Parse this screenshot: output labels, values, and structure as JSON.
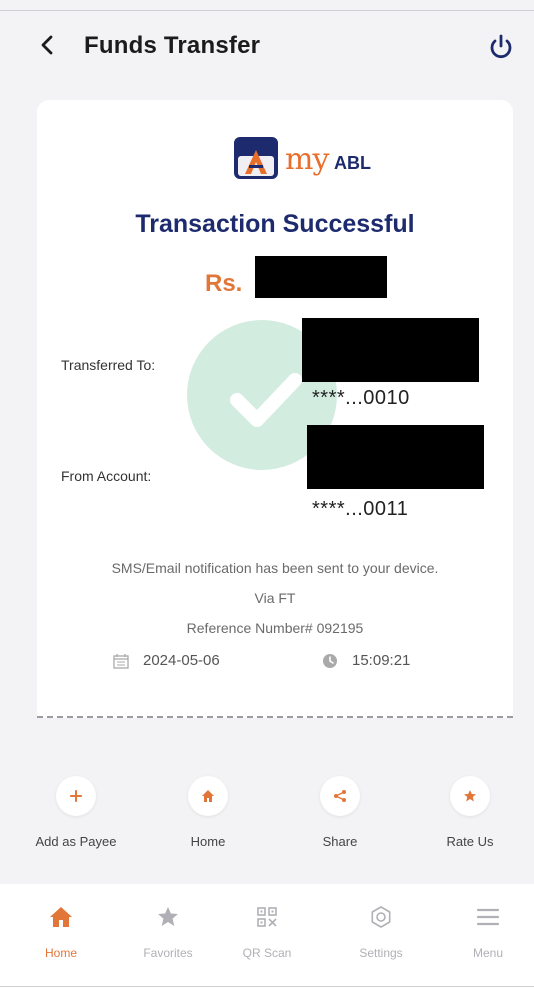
{
  "header": {
    "title": "Funds Transfer",
    "back_icon": "chevron-left-icon",
    "power_icon": "power-icon"
  },
  "receipt": {
    "logo_icon": "myabl-logo",
    "logo_word": "my",
    "logo_abl": "ABL",
    "status": "Transaction Successful",
    "currency": "Rs.",
    "transferred_to_label": "Transferred To:",
    "transferred_to_account": "****...0010",
    "from_account_label": "From Account:",
    "from_account_number": "****...0011",
    "notification": "SMS/Email notification has been sent to your device.",
    "via": "Via FT",
    "reference": "Reference Number# 092195",
    "date": "2024-05-06",
    "time": "15:09:21"
  },
  "actions": [
    {
      "label": "Add as Payee",
      "icon": "plus-icon"
    },
    {
      "label": "Home",
      "icon": "home-icon"
    },
    {
      "label": "Share",
      "icon": "share-icon"
    },
    {
      "label": "Rate Us",
      "icon": "star-icon"
    }
  ],
  "tabs": [
    {
      "label": "Home",
      "icon": "home-icon",
      "active": true
    },
    {
      "label": "Favorites",
      "icon": "star-icon"
    },
    {
      "label": "QR Scan",
      "icon": "qr-code-icon"
    },
    {
      "label": "Settings",
      "icon": "gear-icon"
    },
    {
      "label": "Menu",
      "icon": "hamburger-menu-icon"
    }
  ],
  "colors": {
    "accent": "#e27538",
    "brand_navy": "#1d2b6e",
    "check_bg": "#d3ece0",
    "inactive": "#b0b0b6"
  }
}
